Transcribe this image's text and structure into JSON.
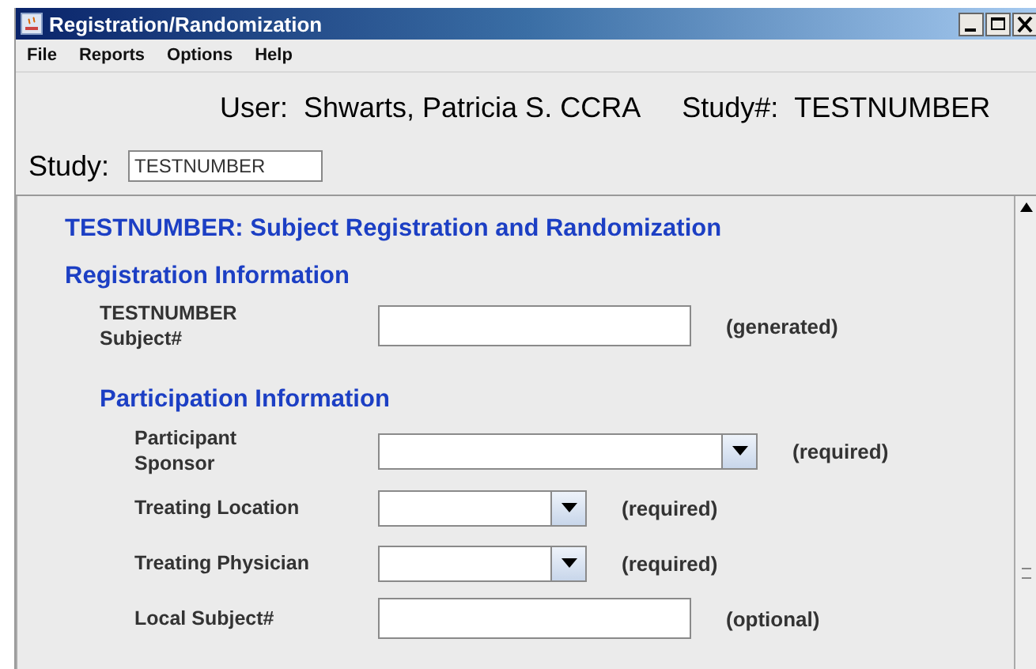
{
  "window": {
    "title": "Registration/Randomization"
  },
  "menu": [
    {
      "label": "File"
    },
    {
      "label": "Reports"
    },
    {
      "label": "Options"
    },
    {
      "label": "Help"
    }
  ],
  "header": {
    "user_label": "User:",
    "user": "Shwarts, Patricia S. CCRA",
    "study_label": "Study#:",
    "study": "TESTNUMBER"
  },
  "study_selector": {
    "label": "Study:",
    "value": "TESTNUMBER"
  },
  "form": {
    "title": "TESTNUMBER: Subject Registration and Randomization",
    "sections": [
      {
        "title": "Registration Information",
        "fields": [
          {
            "kind": "textfield",
            "label": "TESTNUMBER\nSubject#",
            "hint": "(generated)"
          }
        ]
      },
      {
        "title": "Participation Information",
        "fields": [
          {
            "kind": "wideselect",
            "label": "Participant\nSponsor",
            "hint": "(required)"
          },
          {
            "kind": "select",
            "label": "Treating Location",
            "hint": "(required)"
          },
          {
            "kind": "select",
            "label": "Treating Physician",
            "hint": "(required)"
          },
          {
            "kind": "textfield",
            "label": "Local Subject#",
            "hint": "(optional)"
          }
        ]
      }
    ]
  }
}
